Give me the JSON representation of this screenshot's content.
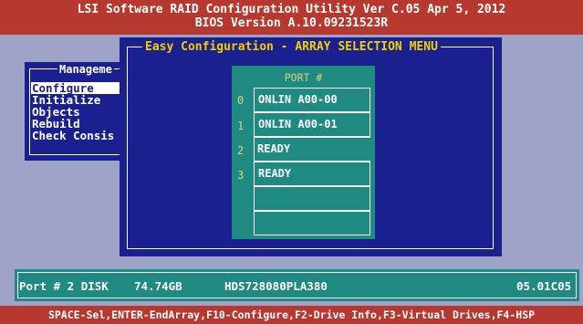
{
  "title_bar": {
    "line1": "LSI Software RAID Configuration Utility Ver C.05 Apr 5, 2012",
    "line2": "BIOS Version   A.10.09231523R"
  },
  "management_menu": {
    "title": "Manageme",
    "items": [
      "Configure",
      "Initialize",
      "Objects",
      "Rebuild",
      "Check Consis"
    ],
    "selected": "Configure"
  },
  "easy_config": {
    "title": "Easy Configuration - ARRAY SELECTION MENU",
    "port_header": "PORT #",
    "ports": [
      {
        "num": "0",
        "status": "ONLIN A00-00"
      },
      {
        "num": "1",
        "status": "ONLIN A00-01"
      },
      {
        "num": "2",
        "status": "READY"
      },
      {
        "num": "3",
        "status": "READY"
      },
      {
        "num": "",
        "status": ""
      },
      {
        "num": "",
        "status": ""
      }
    ],
    "selected_port": "2"
  },
  "status_bar": {
    "port_disk": "Port # 2 DISK",
    "size": "74.74GB",
    "model": "HDS728080PLA380",
    "firmware": "05.01C05"
  },
  "key_help": "SPACE-Sel,ENTER-EndArray,F10-Configure,F2-Drive Info,F3-Virtual Drives,F4-HSP",
  "colors": {
    "background": "#9da4c8",
    "title_bar": "#b7382f",
    "window_blue": "#1a2090",
    "panel_teal": "#1f8a82",
    "title_yellow": "#f2d000",
    "selection_red": "#c0504a"
  }
}
